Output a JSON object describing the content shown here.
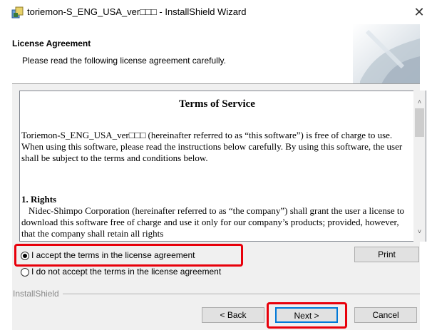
{
  "window": {
    "title": "toriemon-S_ENG_USA_ver□□□ - InstallShield Wizard",
    "close_glyph": "✕"
  },
  "header": {
    "title": "License Agreement",
    "subtitle": "Please read the following license agreement carefully."
  },
  "license": {
    "heading": "Terms of Service",
    "paragraph1": "Toriemon-S_ENG_USA_ver□□□ (hereinafter referred to as “this software”) is free of charge to use.  When using this software, please read the instructions below carefully.  By using this software, the user shall be subject to the terms and conditions below.",
    "rights_heading": "1. Rights",
    "rights_text": "Nidec-Shimpo Corporation (hereinafter referred to as “the company”) shall grant the user a license to download this software free of charge and use it only for our company’s products; provided, however, that the company shall retain all rights"
  },
  "scrollbar": {
    "up_glyph": "˄",
    "down_glyph": "˅"
  },
  "options": {
    "accept_label": "I accept the terms in the license agreement",
    "decline_label": "I do not accept the terms in the license agreement",
    "selected": "accept"
  },
  "buttons": {
    "print": "Print",
    "back": "< Back",
    "next": "Next >",
    "cancel": "Cancel"
  },
  "footer": {
    "brand": "InstallShield"
  },
  "colors": {
    "highlight": "#e8000b",
    "focus": "#0078d7"
  },
  "icons": {
    "app": "installer-icon",
    "close": "close-icon"
  }
}
